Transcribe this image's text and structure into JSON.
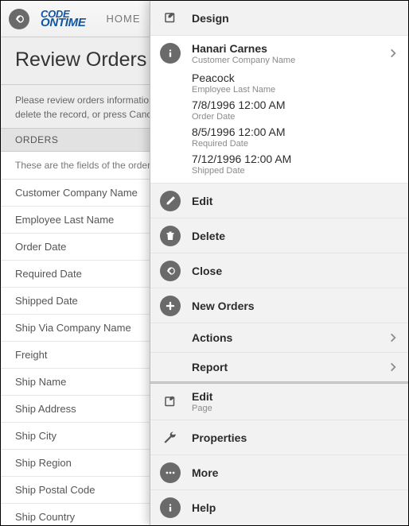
{
  "topbar": {
    "logo_line1": "CODE",
    "logo_line2": "ONTIME",
    "home_label": "HOME"
  },
  "page": {
    "title": "Review Orders",
    "intro": "Please review orders information below. Click Edit to change this record, click Delete to delete the record, or press Cancel/Close to return back.",
    "section": "ORDERS",
    "fields_desc": "These are the fields of the orders record that can be edited."
  },
  "fields": [
    "Customer Company Name",
    "Employee Last Name",
    "Order Date",
    "Required Date",
    "Shipped Date",
    "Ship Via Company Name",
    "Freight",
    "Ship Name",
    "Ship Address",
    "Ship City",
    "Ship Region",
    "Ship Postal Code",
    "Ship Country"
  ],
  "panel": {
    "design_label": "Design",
    "record": {
      "title": "Hanari Carnes",
      "subtitle": "Customer Company Name",
      "employee": {
        "value": "Peacock",
        "label": "Employee Last Name"
      },
      "order_date": {
        "value": "7/8/1996 12:00 AM",
        "label": "Order Date"
      },
      "required_date": {
        "value": "8/5/1996 12:00 AM",
        "label": "Required Date"
      },
      "shipped_date": {
        "value": "7/12/1996 12:00 AM",
        "label": "Shipped Date"
      }
    },
    "actions": {
      "edit": "Edit",
      "delete": "Delete",
      "close": "Close",
      "new": "New Orders",
      "actions": "Actions",
      "report": "Report"
    },
    "dev": {
      "edit": "Edit",
      "edit_sub": "Page",
      "properties": "Properties",
      "more": "More",
      "help": "Help"
    }
  }
}
